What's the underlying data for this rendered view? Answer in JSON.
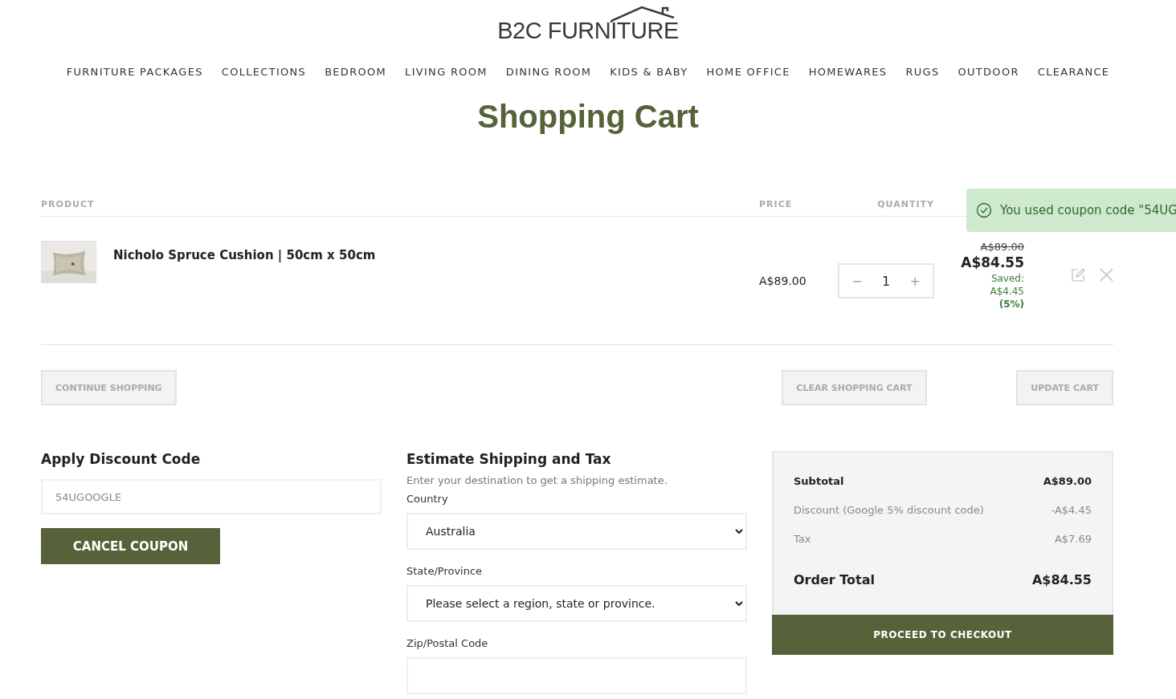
{
  "logo": {
    "text": "B2C FURNITURE"
  },
  "nav": [
    "FURNITURE PACKAGES",
    "COLLECTIONS",
    "BEDROOM",
    "LIVING ROOM",
    "DINING ROOM",
    "KIDS & BABY",
    "HOME OFFICE",
    "HOMEWARES",
    "RUGS",
    "OUTDOOR",
    "CLEARANCE"
  ],
  "title": "Shopping Cart",
  "notice": {
    "text": "You used coupon code \"54UG"
  },
  "table": {
    "columns": [
      "PRODUCT",
      "PRICE",
      "QUANTITY"
    ],
    "rows": [
      {
        "name": "Nicholo Spruce Cushion | 50cm x 50cm",
        "price": "A$89.00",
        "quantity": "1",
        "minus": "−",
        "plus": "+",
        "old_subtotal": "A$89.00",
        "subtotal": "A$84.55",
        "saved": [
          "Saved:",
          "A$4.45",
          "(5%)"
        ]
      }
    ]
  },
  "cart_buttons": [
    "CONTINUE SHOPPING",
    "CLEAR SHOPPING CART",
    "UPDATE CART"
  ],
  "discount": {
    "title": "Apply Discount Code",
    "value": "54UGOOGLE",
    "button": "CANCEL COUPON"
  },
  "shipping": {
    "title": "Estimate Shipping and Tax",
    "hint": "Enter your destination to get a shipping estimate.",
    "fields": [
      {
        "label": "Country",
        "kind": "select",
        "value": "Australia"
      },
      {
        "label": "State/Province",
        "kind": "select",
        "value": "Please select a region, state or province."
      },
      {
        "label": "Zip/Postal Code",
        "kind": "input"
      }
    ]
  },
  "summary": {
    "rows": [
      {
        "label": "Subtotal",
        "value": "A$89.00",
        "kind": "strong"
      },
      {
        "label": "Discount (Google 5% discount code)",
        "value": "-A$4.45",
        "kind": "muted"
      },
      {
        "label": "Tax",
        "value": "A$7.69",
        "kind": "muted"
      }
    ],
    "total": {
      "label": "Order Total",
      "value": "A$84.55"
    },
    "button": "PROCEED TO CHECKOUT"
  }
}
